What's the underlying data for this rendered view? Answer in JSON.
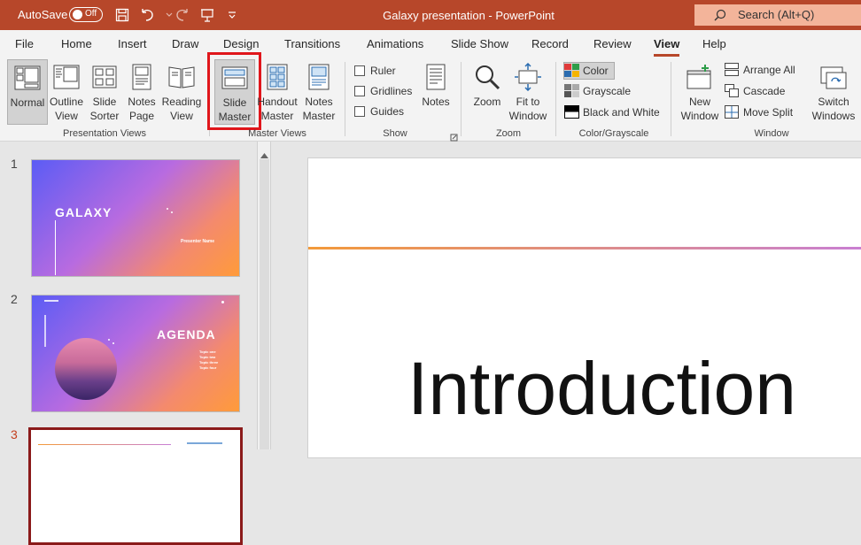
{
  "titlebar": {
    "autosave_label": "AutoSave",
    "autosave_state": "Off",
    "doc_title": "Galaxy presentation - PowerPoint",
    "search_placeholder": "Search (Alt+Q)",
    "icons": [
      "save-icon",
      "undo-icon",
      "redo-icon",
      "present-icon",
      "customize-icon"
    ]
  },
  "tabs": [
    "File",
    "Home",
    "Insert",
    "Draw",
    "Design",
    "Transitions",
    "Animations",
    "Slide Show",
    "Record",
    "Review",
    "View",
    "Help"
  ],
  "active_tab": "View",
  "ribbon": {
    "presentation_views": {
      "label": "Presentation Views",
      "buttons": [
        {
          "line1": "Normal",
          "line2": ""
        },
        {
          "line1": "Outline",
          "line2": "View"
        },
        {
          "line1": "Slide",
          "line2": "Sorter"
        },
        {
          "line1": "Notes",
          "line2": "Page"
        },
        {
          "line1": "Reading",
          "line2": "View"
        }
      ]
    },
    "master_views": {
      "label": "Master Views",
      "buttons": [
        {
          "line1": "Slide",
          "line2": "Master"
        },
        {
          "line1": "Handout",
          "line2": "Master"
        },
        {
          "line1": "Notes",
          "line2": "Master"
        }
      ]
    },
    "show": {
      "label": "Show",
      "checkboxes": [
        "Ruler",
        "Gridlines",
        "Guides"
      ],
      "notes": "Notes"
    },
    "zoom": {
      "label": "Zoom",
      "zoom": "Zoom",
      "fit_line1": "Fit to",
      "fit_line2": "Window"
    },
    "color": {
      "label": "Color/Grayscale",
      "items": [
        "Color",
        "Grayscale",
        "Black and White"
      ]
    },
    "window": {
      "label": "Window",
      "new_line1": "New",
      "new_line2": "Window",
      "items": [
        "Arrange All",
        "Cascade",
        "Move Split"
      ],
      "switch_line1": "Switch",
      "switch_line2": "Windows"
    }
  },
  "thumbnails": [
    {
      "number": "1",
      "title": "GALAXY",
      "subtitle": "Presenter Name"
    },
    {
      "number": "2",
      "title": "AGENDA",
      "items": [
        "Topic one",
        "Topic two",
        "Topic three",
        "Topic four"
      ]
    },
    {
      "number": "3"
    }
  ],
  "slide": {
    "title": "Introduction"
  },
  "colors": {
    "brand": "#b7472a",
    "highlight": "#e0161b",
    "selected_slide": "#c43e1c"
  }
}
